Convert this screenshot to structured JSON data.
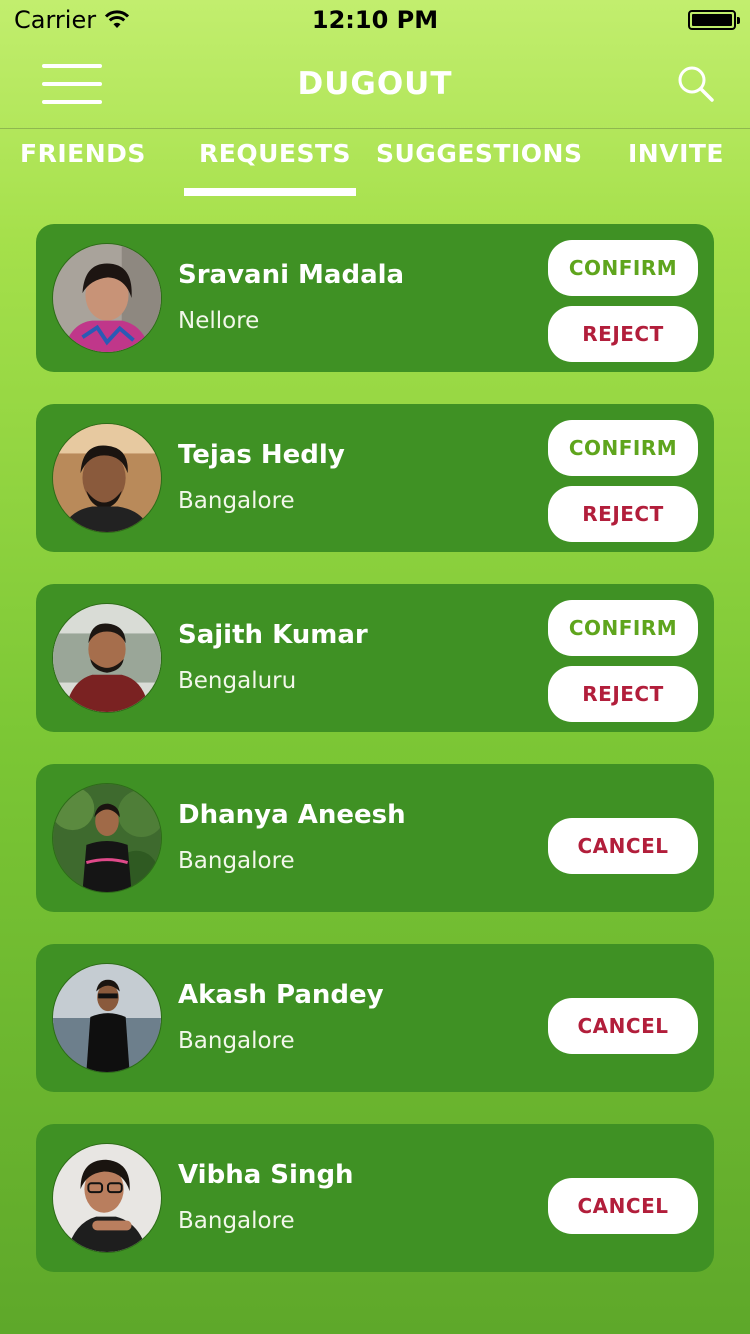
{
  "status_bar": {
    "carrier": "Carrier",
    "time": "12:10 PM"
  },
  "nav": {
    "title": "DUGOUT",
    "menu_icon": "hamburger-menu-icon",
    "search_icon": "search-icon"
  },
  "tabs": [
    {
      "label": "FRIENDS",
      "active": false
    },
    {
      "label": "REQUESTS",
      "active": true
    },
    {
      "label": "SUGGESTIONS",
      "active": false
    },
    {
      "label": "INVITE",
      "active": false
    }
  ],
  "requests": [
    {
      "name": "Sravani Madala",
      "city": "Nellore",
      "confirm": "CONFIRM",
      "reject": "REJECT"
    },
    {
      "name": "Tejas Hedly",
      "city": "Bangalore",
      "confirm": "CONFIRM",
      "reject": "REJECT"
    },
    {
      "name": "Sajith Kumar",
      "city": "Bengaluru",
      "confirm": "CONFIRM",
      "reject": "REJECT"
    },
    {
      "name": "Dhanya Aneesh",
      "city": "Bangalore",
      "cancel": "CANCEL"
    },
    {
      "name": "Akash Pandey",
      "city": "Bangalore",
      "cancel": "CANCEL"
    },
    {
      "name": "Vibha Singh",
      "city": "Bangalore",
      "cancel": "CANCEL"
    }
  ],
  "colors": {
    "card": "#3f9124",
    "confirm_text": "#5fa51d",
    "reject_text": "#b21e3b",
    "header_top": "#c2ee6e",
    "background_bottom": "#5ea82a"
  }
}
